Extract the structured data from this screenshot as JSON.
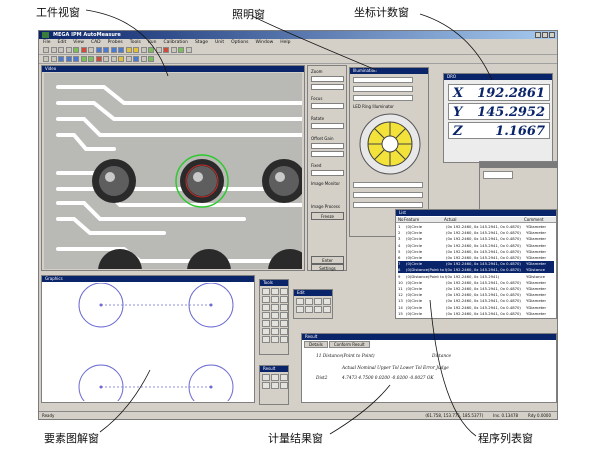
{
  "annotations": {
    "workpiece_window": "工件视窗",
    "lighting_window": "照明窗",
    "coordinate_window": "坐标计数窗",
    "graphics_window": "要素图解窗",
    "result_window": "计量结果窗",
    "program_list_window": "程序列表窗"
  },
  "app": {
    "title": "MEGA IPM AutoMeasure",
    "menu": [
      "File",
      "Edit",
      "View",
      "CAD",
      "Probes",
      "Tools",
      "Run",
      "Calibration",
      "Stage",
      "Unit",
      "Options",
      "Window",
      "Help"
    ],
    "status_text": "Ready",
    "status_cells": [
      "(61.758, 153.775, 185.5377)",
      "Ins. 0.13478",
      "Rdy 0.0000"
    ]
  },
  "video": {
    "title": "Video"
  },
  "side_panel": {
    "zoom_label": "Zoom",
    "focus_label": "Focus",
    "rotate_label": "Rotate",
    "offset_label": "Offset Gain",
    "fixed_label": "Fixed",
    "image_monitor_label": "Image Monitor",
    "image_process_label": "Image Process",
    "freeze_label": "Freeze",
    "enter_label": "Enter",
    "settings_label": "Settings"
  },
  "illumination": {
    "title": "Illumination",
    "ring_label": "LED Ring Illuminator"
  },
  "coord": {
    "title": "DRO",
    "rows": [
      {
        "axis": "X",
        "value": "192.2861"
      },
      {
        "axis": "Y",
        "value": "145.2952"
      },
      {
        "axis": "Z",
        "value": "1.1667"
      }
    ]
  },
  "program_list": {
    "title": "List",
    "headers": [
      "No",
      "Feature",
      "Actual",
      "Comment"
    ],
    "rows": [
      {
        "no": "1",
        "feature": "(0)Circle",
        "actual": "(0x 192.2460, 0x 145.2941, 0x 0.4870)",
        "comment": "YDiameter",
        "selected": false
      },
      {
        "no": "2",
        "feature": "(0)Circle",
        "actual": "(0x 192.2460, 0x 145.2941, 0x 0.4870)",
        "comment": "YDiameter",
        "selected": false
      },
      {
        "no": "3",
        "feature": "(0)Circle",
        "actual": "(0x 192.2460, 0x 145.2941, 0x 0.4870)",
        "comment": "YDiameter",
        "selected": false
      },
      {
        "no": "4",
        "feature": "(0)Circle",
        "actual": "(0x 192.2460, 0x 145.2941, 0x 0.4870)",
        "comment": "YDiameter",
        "selected": false
      },
      {
        "no": "5",
        "feature": "(0)Circle",
        "actual": "(0x 192.2460, 0x 145.2941, 0x 0.4870)",
        "comment": "YDiameter",
        "selected": false
      },
      {
        "no": "6",
        "feature": "(0)Circle",
        "actual": "(0x 192.2460, 0x 145.2941, 0x 0.4870)",
        "comment": "YDiameter",
        "selected": false
      },
      {
        "no": "7",
        "feature": "(0)Circle",
        "actual": "(0x 192.2460, 0x 145.2941, 0x 0.4870)",
        "comment": "YDiameter",
        "selected": true
      },
      {
        "no": "8",
        "feature": "(0)Distance(Point to Point)",
        "actual": "(0x 192.2460, 0x 145.2941, 0x 0.4870)",
        "comment": "YDistance",
        "selected": true
      },
      {
        "no": "9",
        "feature": "(0)Distance(Point to Poi...",
        "actual": "(0x 192.2460, 0x 145.2941)",
        "comment": "YDistance",
        "selected": false
      },
      {
        "no": "10",
        "feature": "(0)Circle",
        "actual": "(0x 192.2460, 0x 145.2941, 0x 0.4870)",
        "comment": "YDiameter",
        "selected": false
      },
      {
        "no": "11",
        "feature": "(0)Circle",
        "actual": "(0x 192.2460, 0x 145.2941, 0x 0.4870)",
        "comment": "YDiameter",
        "selected": false
      },
      {
        "no": "12",
        "feature": "(0)Circle",
        "actual": "(0x 192.2460, 0x 145.2941, 0x 0.4870)",
        "comment": "YDiameter",
        "selected": false
      },
      {
        "no": "13",
        "feature": "(0)Circle",
        "actual": "(0x 192.2460, 0x 145.2941, 0x 0.4870)",
        "comment": "YDiameter",
        "selected": false
      },
      {
        "no": "14",
        "feature": "(0)Circle",
        "actual": "(0x 192.2460, 0x 145.2941, 0x 0.4870)",
        "comment": "YDiameter",
        "selected": false
      },
      {
        "no": "15",
        "feature": "(0)Circle",
        "actual": "(0x 192.2460, 0x 145.2941, 0x 0.4870)",
        "comment": "YDiameter",
        "selected": false
      }
    ]
  },
  "graphics": {
    "title": "Graphics"
  },
  "toolbox": {
    "title": "Tools",
    "edit_title": "Edit",
    "result_title": "Result"
  },
  "result": {
    "title": "Result",
    "tabs": [
      "Details",
      "Conform Result"
    ],
    "line1": "11 Distance(Point to Point)",
    "line1_type": "Distance",
    "header": "Actual    Nominal  Upper Tol  Lower Tol   Error   Judge",
    "dist_label": "Dist2",
    "dist_values": "4.7473    4.7500    0.0200    -0.0200    -0.0027    OK"
  },
  "colors": {
    "titlebar": "#0a246a",
    "selection": "#0a246a",
    "graphics_circles": "#6a6ad2",
    "detection_circle": "#2ec92e",
    "dro_text": "#0a246a",
    "lamp_fill": "#f2e23a"
  }
}
